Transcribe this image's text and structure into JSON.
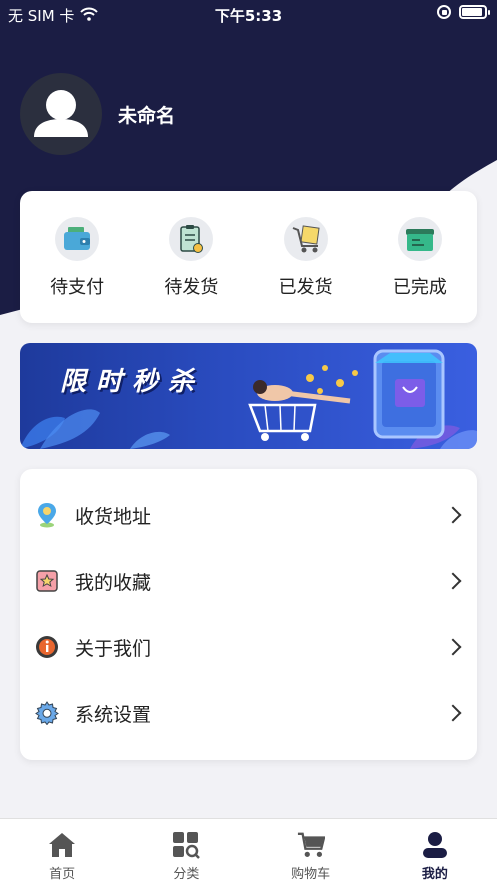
{
  "status_bar": {
    "carrier": "无 SIM 卡",
    "time": "下午5:33"
  },
  "profile": {
    "username": "未命名"
  },
  "orders": [
    {
      "label": "待支付",
      "icon": "wallet-icon"
    },
    {
      "label": "待发货",
      "icon": "clipboard-icon"
    },
    {
      "label": "已发货",
      "icon": "cart-box-icon"
    },
    {
      "label": "已完成",
      "icon": "box-icon"
    }
  ],
  "banner": {
    "title": "限时秒杀"
  },
  "menu": [
    {
      "label": "收货地址",
      "icon": "location-pin-icon"
    },
    {
      "label": "我的收藏",
      "icon": "star-icon"
    },
    {
      "label": "关于我们",
      "icon": "info-icon"
    },
    {
      "label": "系统设置",
      "icon": "gear-icon"
    }
  ],
  "tabs": [
    {
      "label": "首页",
      "icon": "home-icon"
    },
    {
      "label": "分类",
      "icon": "category-icon"
    },
    {
      "label": "购物车",
      "icon": "cart-icon"
    },
    {
      "label": "我的",
      "icon": "user-icon",
      "active": true
    }
  ],
  "colors": {
    "header": "#1b1d44",
    "accent": "#1b1d44",
    "background": "#f2f2f6"
  }
}
